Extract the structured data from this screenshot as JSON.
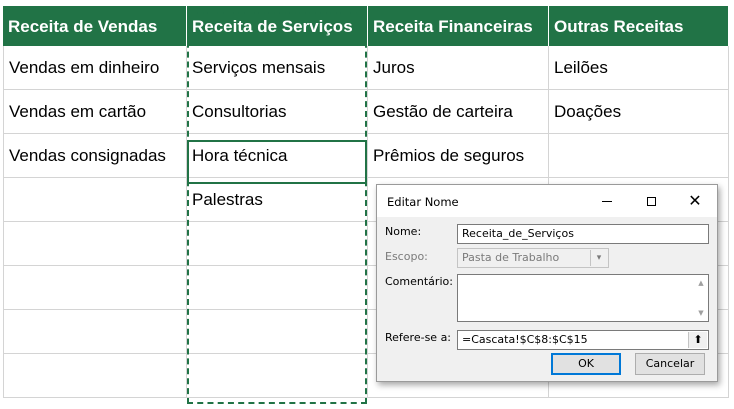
{
  "sheet": {
    "headers": [
      "Receita de Vendas",
      "Receita de Serviços",
      "Receita Financeiras",
      "Outras Receitas"
    ],
    "columns": [
      [
        "Vendas em dinheiro",
        "Vendas em cartão",
        "Vendas consignadas",
        "",
        "",
        "",
        "",
        ""
      ],
      [
        "Serviços mensais",
        "Consultorias",
        "Hora técnica",
        "Palestras",
        "",
        "",
        "",
        ""
      ],
      [
        "Juros",
        "Gestão de carteira",
        "Prêmios de seguros",
        "",
        "",
        "",
        "",
        ""
      ],
      [
        "Leilões",
        "Doações",
        "",
        "",
        "",
        "",
        "",
        ""
      ]
    ],
    "accent_color": "#217346"
  },
  "dialog": {
    "title": "Editar Nome",
    "name_label": "Nome:",
    "name_value": "Receita_de_Serviços",
    "scope_label": "Escopo:",
    "scope_value": "Pasta de Trabalho",
    "comment_label": "Comentário:",
    "comment_value": "",
    "refers_label": "Refere-se a:",
    "refers_value": "=Cascata!$C$8:$C$15",
    "ok_label": "OK",
    "cancel_label": "Cancelar",
    "icons": [
      "minimize-icon",
      "maximize-icon",
      "close-icon",
      "collapse-dialog-icon",
      "chevron-down-icon"
    ]
  }
}
